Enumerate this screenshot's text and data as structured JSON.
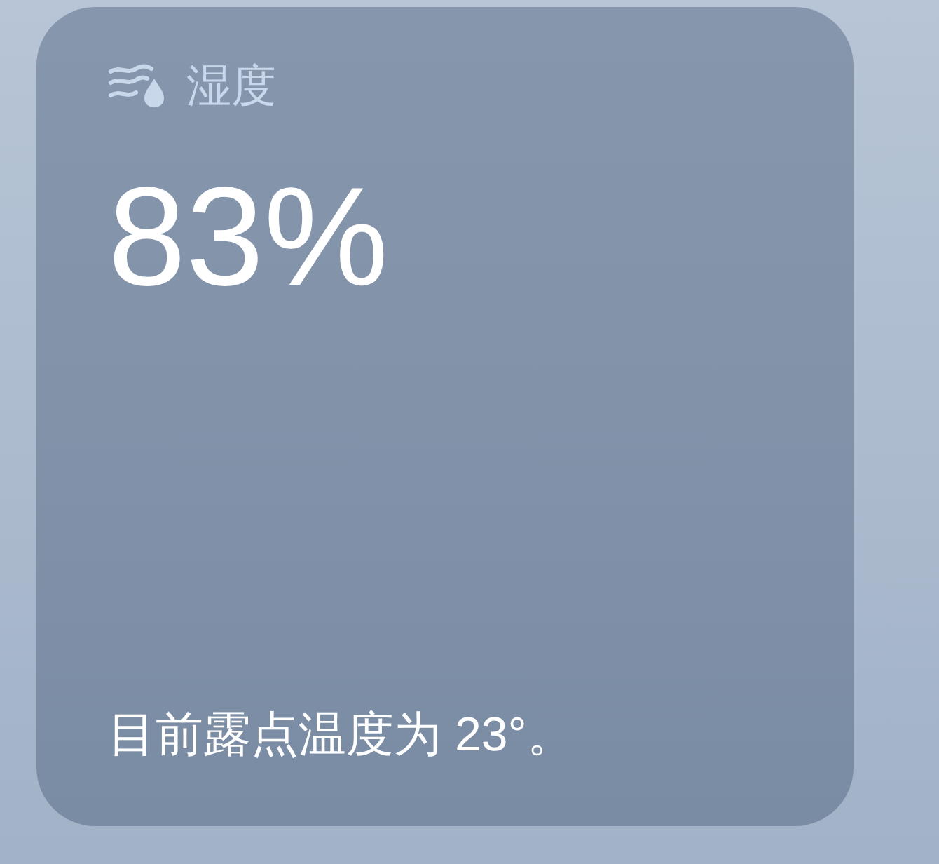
{
  "widget": {
    "title": "湿度",
    "value": "83%",
    "description": "目前露点温度为 23°。"
  }
}
